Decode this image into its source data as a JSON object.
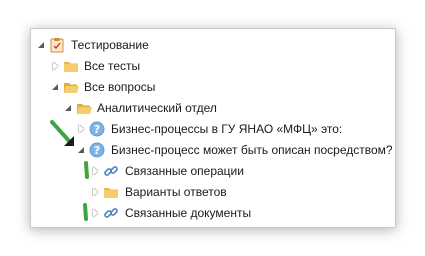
{
  "tree": {
    "root": {
      "label": "Тестирование",
      "expanded": true,
      "icon": "test-document-icon"
    },
    "items": [
      {
        "label": "Все тесты",
        "expanded": false,
        "icon": "folder-icon"
      },
      {
        "label": "Все вопросы",
        "expanded": true,
        "icon": "folder-icon"
      },
      {
        "label": "Аналитический отдел",
        "expanded": true,
        "icon": "folder-icon"
      },
      {
        "label": "Бизнес-процессы в ГУ ЯНАО «МФЦ» это:",
        "expanded": false,
        "icon": "question-icon"
      },
      {
        "label": "Бизнес-процесс может быть описан посредством?",
        "expanded": true,
        "icon": "question-icon"
      },
      {
        "label": "Связанные операции",
        "expanded": false,
        "icon": "link-icon"
      },
      {
        "label": "Варианты ответов",
        "expanded": false,
        "icon": "folder-icon"
      },
      {
        "label": "Связанные документы",
        "expanded": false,
        "icon": "link-icon"
      }
    ]
  },
  "colors": {
    "folder": "#e8b84c",
    "question": "#5b9bd5",
    "highlight_arrow": "#3fa63f"
  }
}
